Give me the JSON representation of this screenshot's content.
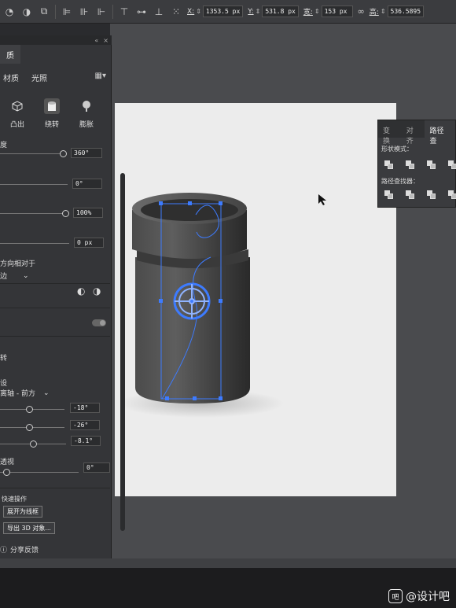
{
  "toolbar": {
    "x_label": "X:",
    "x_value": "1353.5 px",
    "y_label": "Y:",
    "y_value": "531.8 px",
    "w_label": "宽:",
    "w_value": "153 px",
    "h_label": "高:",
    "h_value": "536.5895"
  },
  "panel": {
    "tab_label": "质",
    "subtabs": [
      "材质",
      "光照"
    ],
    "types": [
      {
        "label": "凸出",
        "icon": "extrude-icon"
      },
      {
        "label": "绕转",
        "icon": "revolve-icon"
      },
      {
        "label": "膨胀",
        "icon": "inflate-icon"
      }
    ],
    "section_label": "度",
    "angle_value": "360°",
    "offset_value": "0°",
    "scale_value": "100%",
    "offset_px_value": "0 px",
    "offset_direction_label": "方向相对于",
    "offset_direction_select": "边",
    "rotation_header": "转",
    "preset_label": "设",
    "preset_select": "离轴 - 前方",
    "rot_x": "-18°",
    "rot_y": "-26°",
    "rot_z": "-8.1°",
    "perspective_label": "透视",
    "perspective_value": "0°",
    "quick_actions_label": "快速操作",
    "expand_button": "展开为线框",
    "export_button": "导出 3D 对象...",
    "feedback_label": "分享反馈"
  },
  "pathfinder": {
    "tabs": [
      "变换",
      "对齐",
      "路径查"
    ],
    "shape_modes_label": "形状模式：",
    "pathfinders_label": "路径查找器："
  },
  "watermark": {
    "text": "@设计吧",
    "logo_text": "吧"
  },
  "colors": {
    "selection": "#3d7bff",
    "panel_bg": "#343538",
    "artboard": "#ececec"
  }
}
